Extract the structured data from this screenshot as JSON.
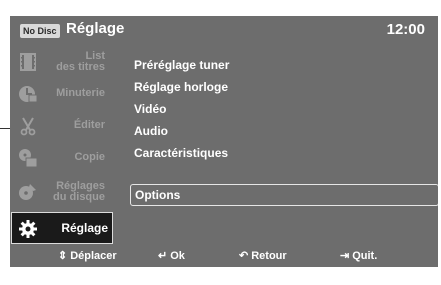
{
  "header": {
    "badge": "No Disc",
    "title": "Réglage",
    "clock": "12:00"
  },
  "sidebar": {
    "items": [
      {
        "line1": "List",
        "line2": "des titres",
        "icon": "film-icon"
      },
      {
        "line1": "Minuterie",
        "line2": "",
        "icon": "timer-icon"
      },
      {
        "line1": "Éditer",
        "line2": "",
        "icon": "scissors-icon"
      },
      {
        "line1": "Copie",
        "line2": "",
        "icon": "copy-icon"
      },
      {
        "line1": "Réglages",
        "line2": "du disque",
        "icon": "disc-settings-icon"
      },
      {
        "line1": "Réglage",
        "line2": "",
        "icon": "gear-icon"
      }
    ],
    "active_index": 5
  },
  "menu": {
    "items": [
      "Préréglage tuner",
      "Réglage horloge",
      "Vidéo",
      "Audio",
      "Caractéristiques",
      "Options"
    ],
    "selected_index": 5
  },
  "footer": {
    "move": {
      "icon": "up-down-icon",
      "label": "Déplacer"
    },
    "ok": {
      "icon": "enter-icon",
      "label": "Ok"
    },
    "back": {
      "icon": "return-icon",
      "label": "Retour"
    },
    "quit": {
      "icon": "exit-icon",
      "label": "Quit."
    }
  },
  "colors": {
    "background": "#6d6d6d",
    "active_item": "#1a1a1a",
    "text": "#ffffff",
    "dim_text": "#9e9e9e"
  }
}
